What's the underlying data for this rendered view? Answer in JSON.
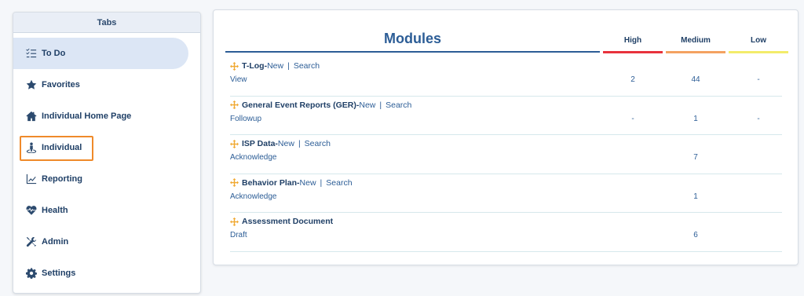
{
  "sidebar": {
    "header": "Tabs",
    "items": [
      {
        "label": "To Do",
        "icon": "todo-list-icon"
      },
      {
        "label": "Favorites",
        "icon": "star-icon"
      },
      {
        "label": "Individual Home Page",
        "icon": "home-icon"
      },
      {
        "label": "Individual",
        "icon": "person-icon"
      },
      {
        "label": "Reporting",
        "icon": "chart-line-icon"
      },
      {
        "label": "Health",
        "icon": "heart-pulse-icon"
      },
      {
        "label": "Admin",
        "icon": "tools-icon"
      },
      {
        "label": "Settings",
        "icon": "gear-icon"
      }
    ]
  },
  "main": {
    "title": "Modules",
    "columns": {
      "high": "High",
      "medium": "Medium",
      "low": "Low"
    },
    "colors": {
      "high": "#e8323c",
      "medium": "#f4a261",
      "low": "#f3ec6a",
      "highlight": "#ef8a2a"
    },
    "modules": [
      {
        "name": "T-Log",
        "dash": " - ",
        "new": "New",
        "sep": "|",
        "search": "Search",
        "sub": "View",
        "high": "2",
        "medium": "44",
        "low": "-"
      },
      {
        "name": "General Event Reports (GER)",
        "dash": " - ",
        "new": "New",
        "sep": "|",
        "search": "Search",
        "sub": "Followup",
        "high": "-",
        "medium": "1",
        "low": "-"
      },
      {
        "name": "ISP Data",
        "dash": " - ",
        "new": "New",
        "sep": "|",
        "search": "Search",
        "sub": "Acknowledge",
        "high": "",
        "medium": "7",
        "low": ""
      },
      {
        "name": "Behavior Plan",
        "dash": " - ",
        "new": "New",
        "sep": "|",
        "search": "Search",
        "sub": "Acknowledge",
        "high": "",
        "medium": "1",
        "low": ""
      },
      {
        "name": "Assessment Document",
        "dash": "",
        "new": "",
        "sep": "",
        "search": "",
        "sub": "Draft",
        "high": "",
        "medium": "6",
        "low": ""
      }
    ]
  }
}
